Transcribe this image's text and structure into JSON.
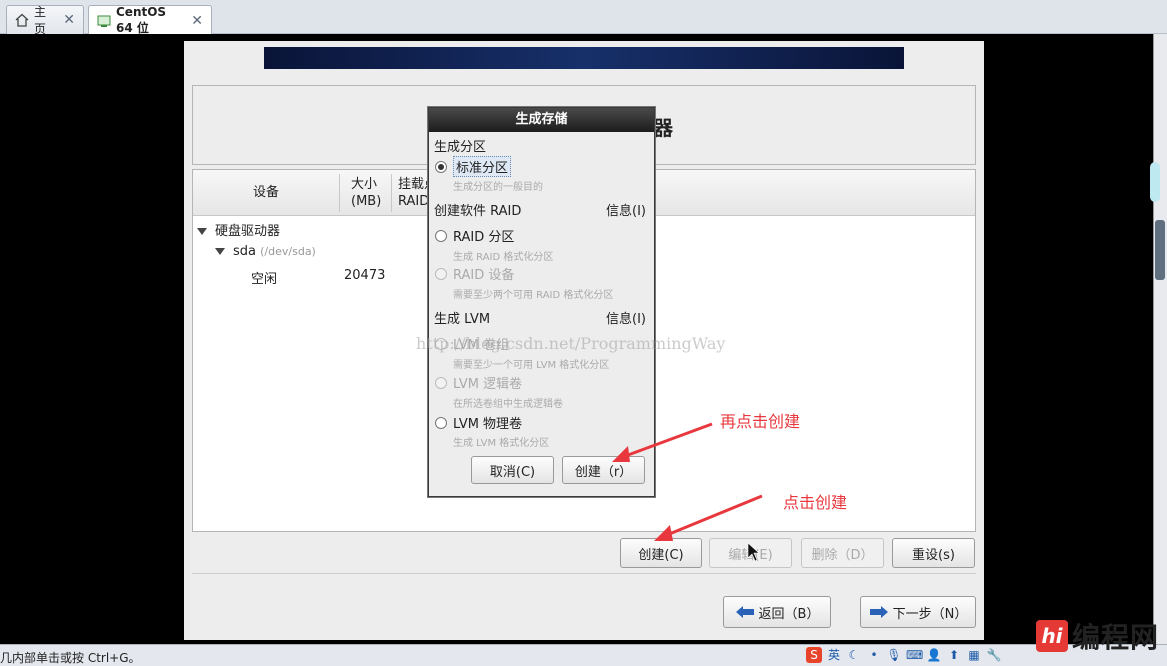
{
  "tabs": [
    {
      "label": "主页",
      "icon": "home-icon"
    },
    {
      "label": "CentOS 64 位",
      "icon": "vm-icon",
      "active": true
    }
  ],
  "installer": {
    "title_partial": "器",
    "columns": {
      "device": "设备",
      "size": "大小\n(MB)",
      "size_line1": "大小",
      "size_line2": "(MB)",
      "mount_line1": "挂载点",
      "mount_line2": "RAID"
    },
    "tree": {
      "group": "硬盘驱动器",
      "disk": "sda",
      "disk_path": "(/dev/sda)",
      "free_label": "空闲",
      "free_size": "20473"
    },
    "buttons": {
      "create": "创建(C)",
      "edit": "编辑(E)",
      "delete": "删除（D）",
      "reset": "重设(s)",
      "back": "返回（B）",
      "next": "下一步（N）"
    }
  },
  "dialog": {
    "title": "生成存储",
    "sec_partition": "生成分区",
    "opt_standard": "标准分区",
    "desc_standard": "生成分区的一般目的",
    "sec_raid": "创建软件 RAID",
    "info_raid": "信息(I)",
    "opt_raid_part": "RAID 分区",
    "desc_raid_part": "生成 RAID 格式化分区",
    "opt_raid_dev": "RAID 设备",
    "desc_raid_dev": "需要至少两个可用 RAID 格式化分区",
    "sec_lvm": "生成 LVM",
    "info_lvm": "信息(I)",
    "opt_lvm_vg": "LVM 卷组",
    "desc_lvm_vg": "需要至少一个可用 LVM 格式化分区",
    "opt_lvm_lv": "LVM 逻辑卷",
    "desc_lvm_lv": "在所选卷组中生成逻辑卷",
    "opt_lvm_pv": "LVM 物理卷",
    "desc_lvm_pv": "生成 LVM 格式化分区",
    "cancel": "取消(C)",
    "create": "创建（r）"
  },
  "annotations": {
    "click_create_again": "再点击创建",
    "click_create": "点击创建"
  },
  "watermark": "http://blog.csdn.net/ProgrammingWay",
  "status": {
    "hint": "几内部单击或按 Ctrl+G。",
    "ime": "英"
  },
  "logo": {
    "mark": "hi",
    "text": "编程网"
  },
  "colors": {
    "annotation": "#e8383d",
    "banner": "#17306a",
    "titlebar": "#1c1c1c"
  }
}
